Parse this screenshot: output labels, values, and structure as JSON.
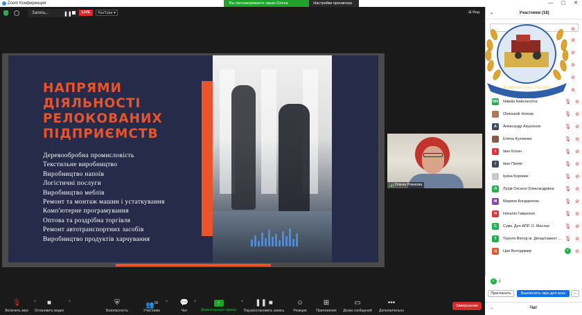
{
  "window": {
    "title": "Zoom Конференция",
    "controls": [
      "—",
      "▢",
      "✕"
    ]
  },
  "banner": {
    "viewing": "Вы просматриваете экран Олена Рожкова",
    "options": "Настройки просмотра ▾"
  },
  "topbar": {
    "recording": "Запись...",
    "pause": "❚❚",
    "live": "LIVE",
    "platform": "YouTube ▾",
    "view": "⊞ Вид"
  },
  "slide": {
    "title": "НАПРЯМИ ДІЯЛЬНОСТІ РЕЛОКОВАНИХ ПІДПРИЄМСТВ",
    "items": [
      "Деревообробна промисловість",
      "Текстильне виробництво",
      "Виробництво напоїв",
      "Логістичні послуги",
      "Виробництво меблів",
      "Ремонт та монтаж машин і устаткування",
      "Комп'ютерне програмування",
      "Оптова та роздрібна торгівля",
      "Ремонт автотранспортних засобів",
      "Виробництво продуктів харчування"
    ]
  },
  "video": {
    "name": "Олена Рожкова"
  },
  "toolbar": {
    "mute": "Включить звук",
    "video": "Остановить видео",
    "security": "Безопасность",
    "participants": "Участники",
    "participants_count": "18",
    "chat": "Чат",
    "share": "Демонстрация экрана",
    "pause_recording": "Пауза/остановить запись",
    "reactions": "Реакции",
    "apps": "Приложения",
    "whiteboard": "Доски сообщений",
    "more": "Дополнительно",
    "end": "Завершение"
  },
  "panel": {
    "title": "Участники (18)",
    "emblem_text": "Аграрний союз України",
    "participants": [
      {
        "name": "Natalia Nakonechna",
        "initials": "NN",
        "color": "#23b14d",
        "status": "muted"
      },
      {
        "name": "Oleksandr Homan",
        "initials": "",
        "color": "#b07a5a",
        "status": "muted"
      },
      {
        "name": "Александр Акуюонов",
        "initials": "А",
        "color": "#3b4a5c",
        "status": "muted"
      },
      {
        "name": "Елена Кулякова",
        "initials": "",
        "color": "#8a5a44",
        "status": "muted"
      },
      {
        "name": "Іван Кохан",
        "initials": "І",
        "color": "#d9363e",
        "status": "muted"
      },
      {
        "name": "Іван Пиляк",
        "initials": "І",
        "color": "#3b4a5c",
        "status": "muted"
      },
      {
        "name": "Ірина Боровик",
        "initials": "",
        "color": "#c9c9c9",
        "status": "muted"
      },
      {
        "name": "Луців Оксана Олександрівна",
        "initials": "Л",
        "color": "#23b14d",
        "status": "muted"
      },
      {
        "name": "Марина Бондаренко",
        "initials": "М",
        "color": "#8e44ad",
        "status": "muted"
      },
      {
        "name": "Наталія Гаврилюк",
        "initials": "Н",
        "color": "#d9363e",
        "status": "muted"
      },
      {
        "name": "Сумк. Деп АПР. О. Маслак",
        "initials": "С",
        "color": "#23b14d",
        "status": "muted"
      },
      {
        "name": "Тереля Віктор ів. Департамент ...",
        "initials": "Т",
        "color": "#23b14d",
        "status": "muted"
      },
      {
        "name": "Цап Володимир",
        "initials": "Ц",
        "color": "#e8542c",
        "status": "unmuted"
      }
    ],
    "raised_count": "1",
    "invite": "Пригласить",
    "mute_all": "Выключить звук для всех",
    "more": "...",
    "chat": "Чат"
  }
}
